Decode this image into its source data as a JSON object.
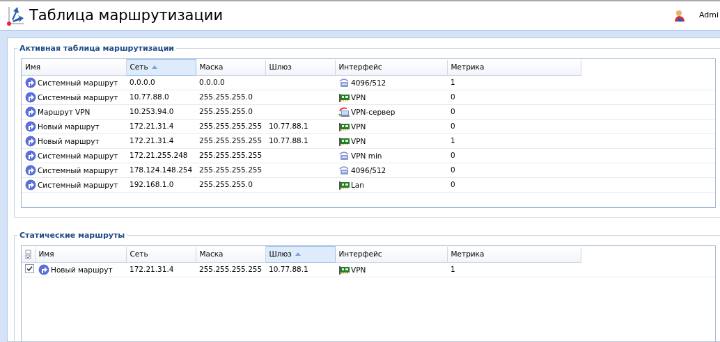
{
  "page": {
    "title": "Таблица маршрутизации",
    "user": "Admi"
  },
  "active": {
    "legend": "Активная таблица маршрутизации",
    "columns": [
      {
        "label": "Имя",
        "sorted": false
      },
      {
        "label": "Сеть",
        "sorted": true
      },
      {
        "label": "Маска",
        "sorted": false
      },
      {
        "label": "Шлюз",
        "sorted": false
      },
      {
        "label": "Интерфейс",
        "sorted": false
      },
      {
        "label": "Метрика",
        "sorted": false
      }
    ],
    "rows": [
      {
        "name": "Системный маршрут",
        "network": "0.0.0.0",
        "mask": "0.0.0.0",
        "gateway": "",
        "interface": {
          "kind": "modem",
          "label": "4096/512"
        },
        "metric": "1"
      },
      {
        "name": "Системный маршрут",
        "network": "10.77.88.0",
        "mask": "255.255.255.0",
        "gateway": "",
        "interface": {
          "kind": "card",
          "label": "VPN"
        },
        "metric": "0"
      },
      {
        "name": "Маршрут VPN",
        "network": "10.253.94.0",
        "mask": "255.255.255.0",
        "gateway": "",
        "interface": {
          "kind": "server",
          "label": "VPN-сервер"
        },
        "metric": "0"
      },
      {
        "name": "Новый маршрут",
        "network": "172.21.31.4",
        "mask": "255.255.255.255",
        "gateway": "10.77.88.1",
        "interface": {
          "kind": "card",
          "label": "VPN"
        },
        "metric": "0"
      },
      {
        "name": "Новый маршрут",
        "network": "172.21.31.4",
        "mask": "255.255.255.255",
        "gateway": "10.77.88.1",
        "interface": {
          "kind": "card",
          "label": "VPN"
        },
        "metric": "1"
      },
      {
        "name": "Системный маршрут",
        "network": "172.21.255.248",
        "mask": "255.255.255.255",
        "gateway": "",
        "interface": {
          "kind": "modem",
          "label": "VPN min"
        },
        "metric": "0"
      },
      {
        "name": "Системный маршрут",
        "network": "178.124.148.254",
        "mask": "255.255.255.255",
        "gateway": "",
        "interface": {
          "kind": "modem",
          "label": "4096/512"
        },
        "metric": "0"
      },
      {
        "name": "Системный маршрут",
        "network": "192.168.1.0",
        "mask": "255.255.255.0",
        "gateway": "",
        "interface": {
          "kind": "card",
          "label": "Lan"
        },
        "metric": "0"
      }
    ]
  },
  "static": {
    "legend": "Статические маршруты",
    "columns": [
      {
        "label": "Имя",
        "sorted": false
      },
      {
        "label": "Сеть",
        "sorted": false
      },
      {
        "label": "Маска",
        "sorted": false
      },
      {
        "label": "Шлюз",
        "sorted": true
      },
      {
        "label": "Интерфейс",
        "sorted": false
      },
      {
        "label": "Метрика",
        "sorted": false
      }
    ],
    "rows": [
      {
        "checked": true,
        "name": "Новый маршрут",
        "network": "172.21.31.4",
        "mask": "255.255.255.255",
        "gateway": "10.77.88.1",
        "interface": {
          "kind": "card",
          "label": "VPN"
        },
        "metric": "1"
      }
    ]
  }
}
